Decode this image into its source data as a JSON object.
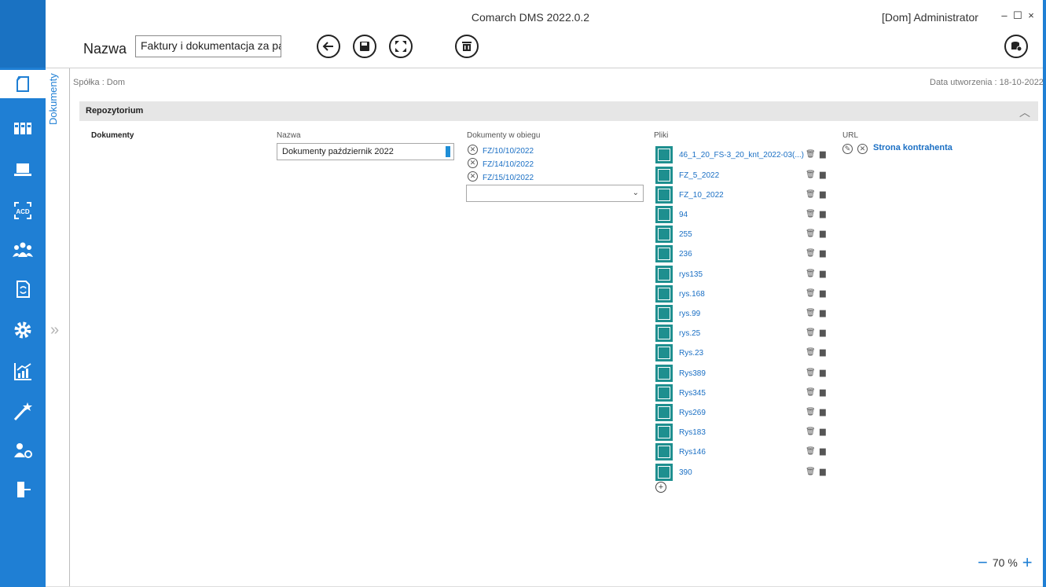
{
  "header": {
    "app_title": "Comarch DMS 2022.0.2",
    "user": "[Dom]  Administrator",
    "name_label": "Nazwa",
    "name_value": "Faktury i dokumentacja za pa",
    "window_min": "–",
    "window_max": "☐",
    "window_close": "×"
  },
  "sidebar": {
    "icons": [
      "documents-icon",
      "library-icon",
      "laptop-icon",
      "ocr-icon",
      "users-icon",
      "workflow-icon",
      "settings-icon",
      "reports-icon",
      "wizard-icon",
      "user-settings-icon",
      "logout-icon"
    ],
    "active_index": 0,
    "accent": "#1f7fd4"
  },
  "side_tab": {
    "label": "Dokumenty",
    "expand": "»"
  },
  "meta": {
    "company": "Spółka : Dom",
    "created": "Data utworzenia : 18-10-2022"
  },
  "section": {
    "title": "Repozytorium",
    "chevron": "︿"
  },
  "form": {
    "row_label": "Dokumenty",
    "name_col_label": "Nazwa",
    "name_value": "Dokumenty październik 2022",
    "docs_col_label": "Dokumenty w obiegu",
    "docs": [
      "FZ/10/10/2022",
      "FZ/14/10/2022",
      "FZ/15/10/2022"
    ],
    "files_col_label": "Pliki",
    "files": [
      "46_1_20_FS-3_20_knt_2022-03(...)",
      "FZ_5_2022",
      "FZ_10_2022",
      "94",
      "255",
      "236",
      "rys135",
      "rys.168",
      "rys.99",
      "rys.25",
      "Rys.23",
      "Rys389",
      "Rys345",
      "Rys269",
      "Rys183",
      "Rys146",
      "390"
    ],
    "url_col_label": "URL",
    "url_link": "Strona kontrahenta"
  },
  "zoom": {
    "minus": "−",
    "value": "70 %",
    "plus": "+"
  }
}
